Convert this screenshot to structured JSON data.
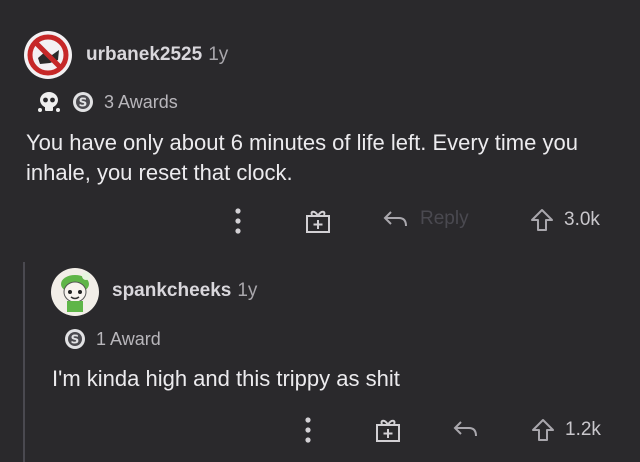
{
  "comments": [
    {
      "username": "urbanek2525",
      "age": "1y",
      "awards_label": "3 Awards",
      "body": "You have only about 6 minutes of life left. Every time you inhale, you reset that clock.",
      "actions": {
        "more": "more-icon",
        "gift": "gift-icon",
        "reply_label": "Reply",
        "upvote_count": "3.0k"
      }
    },
    {
      "username": "spankcheeks",
      "age": "1y",
      "awards_label": "1 Award",
      "body": "I'm kinda high and this trippy as shit",
      "actions": {
        "more": "more-icon",
        "gift": "gift-icon",
        "upvote_count": "1.2k"
      }
    }
  ],
  "colors": {
    "background": "#2a292c",
    "avatar1": "#c62828",
    "avatar2": "#f2eee8"
  }
}
